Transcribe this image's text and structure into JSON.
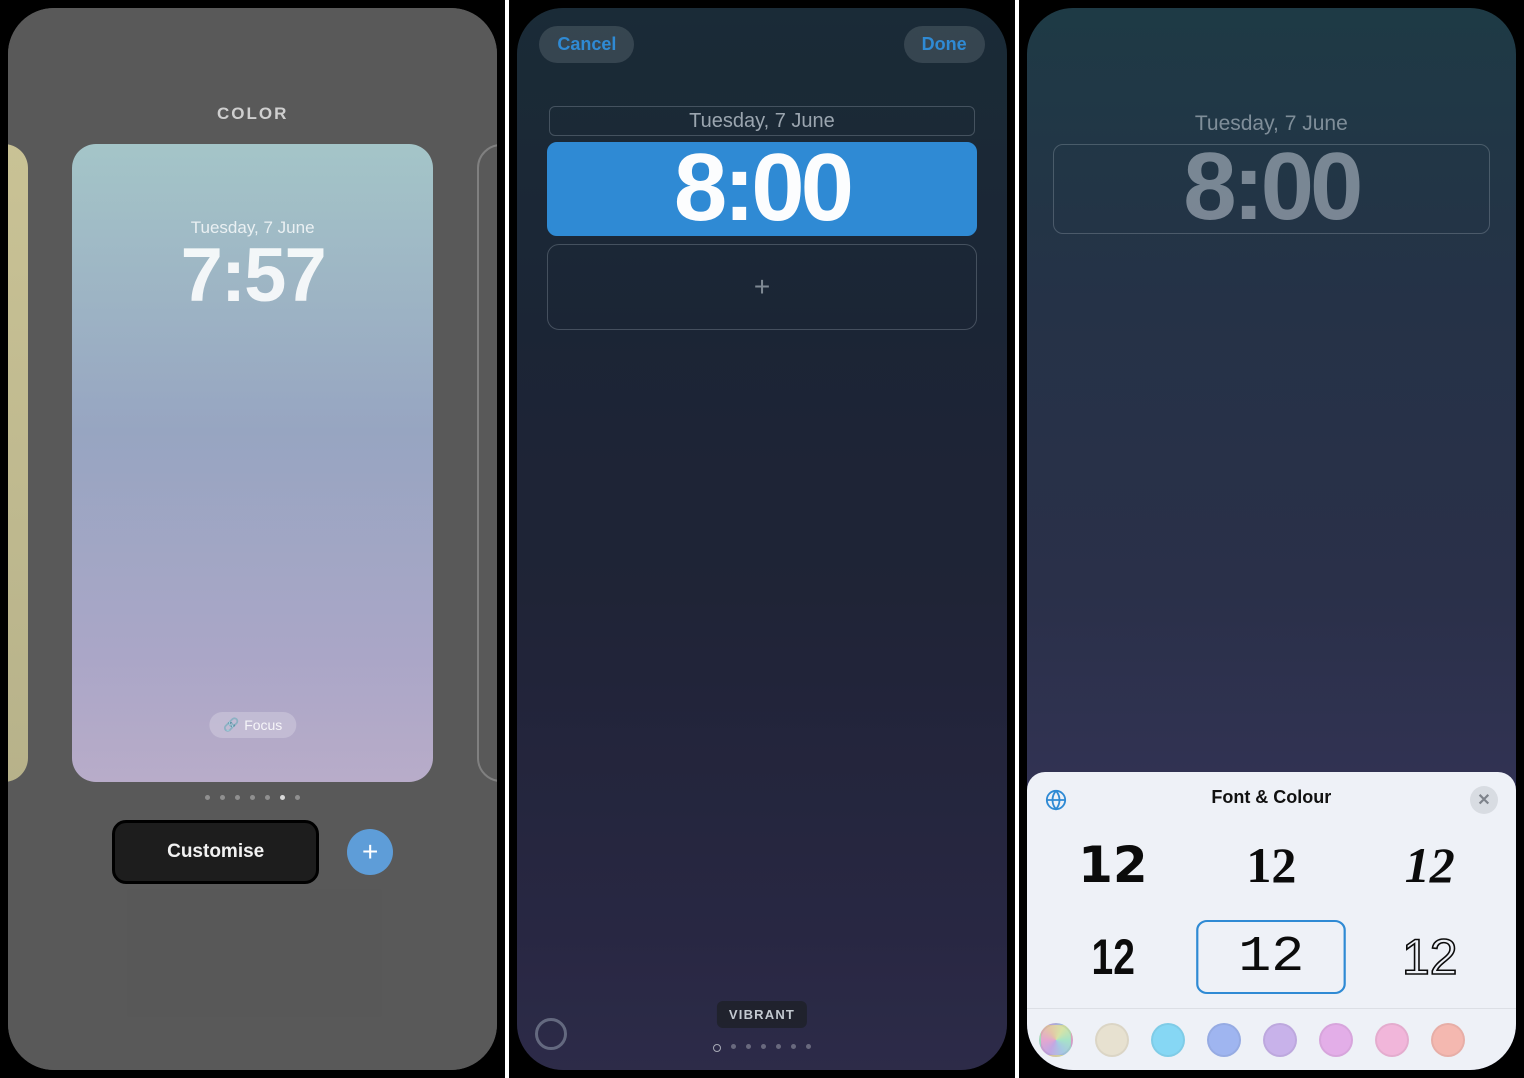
{
  "panel1": {
    "header": "COLOR",
    "date": "Tuesday, 7 June",
    "time": "7:57",
    "focus_label": "Focus",
    "customise_label": "Customise",
    "add_label": "+"
  },
  "panel2": {
    "cancel": "Cancel",
    "done": "Done",
    "date": "Tuesday, 7 June",
    "time": "8:00",
    "add_widget": "+",
    "style_label": "VIBRANT"
  },
  "panel3": {
    "date": "Tuesday, 7 June",
    "time": "8:00",
    "sheet": {
      "title": "Font & Colour",
      "close": "✕",
      "fonts": [
        "12",
        "12",
        "12",
        "12",
        "12",
        "12"
      ],
      "selected_index": 4,
      "colors": [
        "gradient",
        "#e7e1d0",
        "#86d7f4",
        "#9fb5f0",
        "#c8b2ea",
        "#e3aee8",
        "#f1b6da",
        "#f4b8b0"
      ]
    }
  }
}
